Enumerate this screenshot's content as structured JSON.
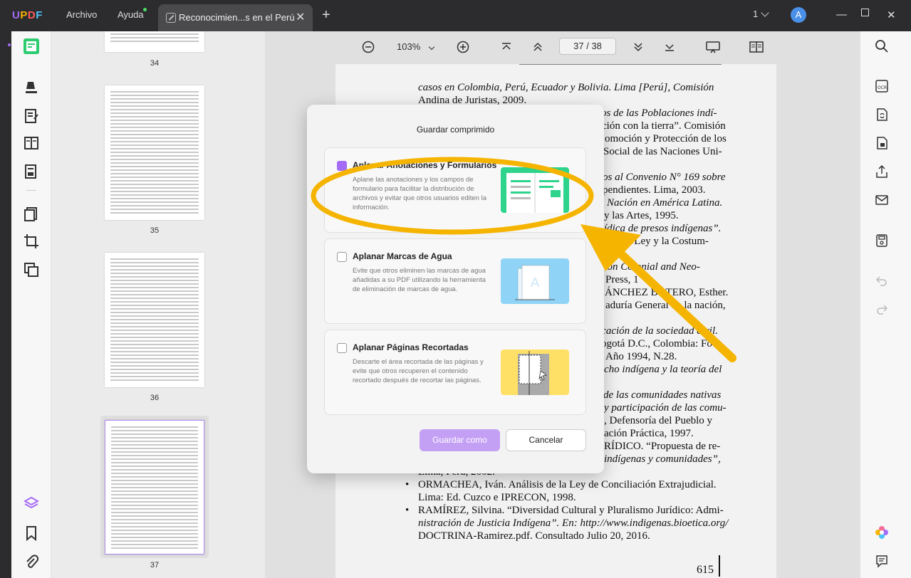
{
  "app": {
    "name": "UPDF",
    "menu_archivo": "Archivo",
    "menu_ayuda": "Ayuda",
    "tab_title": "Reconocimien...s en el Perú",
    "window_count": "1",
    "avatar_letter": "A"
  },
  "toolbar": {
    "zoom": "103%",
    "current_page": "37",
    "sep": "/",
    "total_pages": "38"
  },
  "thumbnails": [
    {
      "num": "34"
    },
    {
      "num": "35"
    },
    {
      "num": "36"
    },
    {
      "num": "37"
    }
  ],
  "page": {
    "lines": [
      "casos en Colombia, Perú, Ecuador y Bolivia. Lima [Perú], Comisión",
      "Andina de Juristas, 2009.",
      "os de las Poblaciones indí-",
      "ción con la tierra”. Comisión",
      "omoción y Protección de los",
      "Social de las Naciones Uni-",
      "os al Convenio N° 169 sobre",
      "pendientes. Lima, 2003.",
      "Nación en América Latina.",
      "y las Artes, 1995.",
      "ídica de presos indígenas”.",
      "entre la Ley y la Costum-",
      "lución Colonial and Neo-",
      "Press, 1",
      "ÁNCHEZ BOTERO, Esther.",
      "aduría General de la nación,",
      "icación de la sociedad civil.",
      "ogotá D.C., Colombia: Fo-",
      "Año 1994, N.28.",
      "cho indígena y la teoría del",
      "de las comunidades nativas",
      "y participación de las comu-",
      ", Defensoría del Pueblo y",
      "ación Práctica, 1997.",
      "RÍDICO. “Propuesta de re-",
      "indígenas y comunidades”,",
      "Lima, Perú, 2002.",
      "ORMACHEA, Iván. Análisis de la Ley de Conciliación Extrajudicial.",
      "Lima: Ed. Cuzco e IPRECON, 1998.",
      "RAMÍREZ, Silvina. “Diversidad Cultural y Pluralismo Jurídico: Admi-",
      "nistración de Justicia Indígena”. En: http://www.indigenas.bioetica.org/",
      "DOCTRINA-Ramirez.pdf. Consultado Julio 20, 2016."
    ],
    "bullet": "•",
    "page_number": "615"
  },
  "dialog": {
    "title": "Guardar comprimido",
    "options": [
      {
        "title": "Aplanar Anotaciones y Formularios",
        "desc": "Aplane las anotaciones y los campos de formulario para facilitar la distribución de archivos y evitar que otros usuarios editen la información.",
        "checked": true
      },
      {
        "title": "Aplanar Marcas de Agua",
        "desc": "Evite que otros eliminen las marcas de agua añadidas a su PDF utilizando la herramienta de eliminación de marcas de agua.",
        "checked": false
      },
      {
        "title": "Aplanar Páginas Recortadas",
        "desc": "Descarte el área recortada de las páginas y evite que otros recuperen el contenido recortado después de recortar las páginas.",
        "checked": false
      }
    ],
    "save_label": "Guardar como",
    "cancel_label": "Cancelar"
  },
  "colors": {
    "accent": "#a46bf5",
    "highlight": "#f5b400",
    "titlebar": "#2c2c2e"
  }
}
